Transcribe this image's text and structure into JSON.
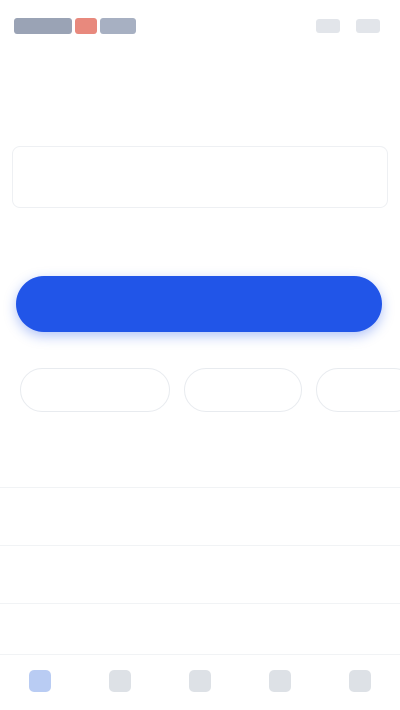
{
  "header": {
    "logo_icon": "brand-logo",
    "right_icons": [
      "help-icon",
      "menu-icon"
    ]
  },
  "colors": {
    "primary": "#2155e8",
    "logo_accent": "#e8897d"
  },
  "title": "",
  "search": {
    "placeholder": "",
    "value": ""
  },
  "location_link": "",
  "search_button_label": "",
  "tabs": [
    {
      "label": ""
    },
    {
      "label": ""
    },
    {
      "label": ""
    }
  ],
  "recent": {
    "heading": "",
    "items": [
      {
        "label": "",
        "action": ""
      },
      {
        "label": "",
        "action": ""
      },
      {
        "label": "",
        "action": ""
      },
      {
        "label": "",
        "action": ""
      }
    ]
  },
  "bottom_nav": [
    {
      "icon": "home-icon",
      "label": ""
    },
    {
      "icon": "star-icon",
      "label": ""
    },
    {
      "icon": "cart-icon",
      "label": ""
    },
    {
      "icon": "bell-icon",
      "label": ""
    },
    {
      "icon": "user-icon",
      "label": ""
    }
  ]
}
